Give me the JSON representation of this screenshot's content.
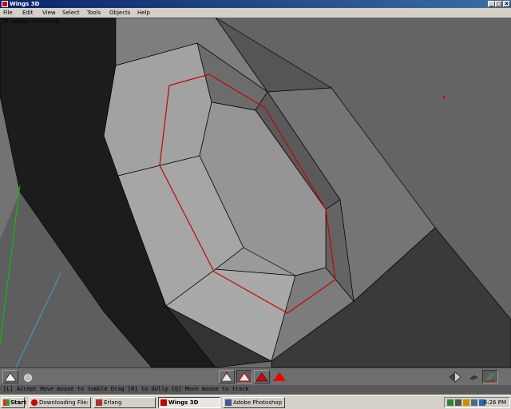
{
  "window": {
    "title": "Wings 3D",
    "controls": {
      "minimize": "_",
      "maximize": "□",
      "close": "x"
    }
  },
  "menubar": {
    "items": [
      "File",
      "Edit",
      "View",
      "Select",
      "Tools",
      "Objects",
      "Help"
    ]
  },
  "viewport": {
    "status_message": "10 edges selected",
    "colors": {
      "background": "#707070",
      "face_light": "#9c9c9c",
      "face_mid": "#8a8a8a",
      "face_dark": "#575757",
      "face_black": "#1c1c1c",
      "edge": "#000000",
      "selected_edge": "#cc0000",
      "axis_x": "#cc0000",
      "axis_y": "#00cc00",
      "axis_z": "#3fa0c8"
    }
  },
  "toolbar": {
    "left_icons": [
      "workmode-icon",
      "smooth-shading-icon"
    ],
    "selection_icons": [
      "vertex-select-icon",
      "edge-select-icon",
      "face-select-icon",
      "body-select-icon"
    ],
    "active_selection": "edge-select-icon",
    "right_icons": [
      "orthographic-view-icon",
      "ground-plane-icon",
      "show-axes-icon"
    ]
  },
  "info_line": "[L] Accept  Move mouse to tumble  Drag [R] to dolly  [Q] Move mouse to track",
  "taskbar": {
    "start_label": "Start",
    "tasks": [
      {
        "label": "Downloading File: /wings/...",
        "icon": "opera-icon",
        "active": false
      },
      {
        "label": "Erlang",
        "icon": "erlang-icon",
        "active": false
      },
      {
        "label": "Wings 3D",
        "icon": "wings-icon",
        "active": true
      },
      {
        "label": "Adobe Photoshop",
        "icon": "photoshop-icon",
        "active": false
      }
    ],
    "tray_icons": [
      "network-icon",
      "volume-icon",
      "antivirus-icon",
      "display-icon",
      "messenger-icon"
    ],
    "clock": "6:26 PM"
  }
}
